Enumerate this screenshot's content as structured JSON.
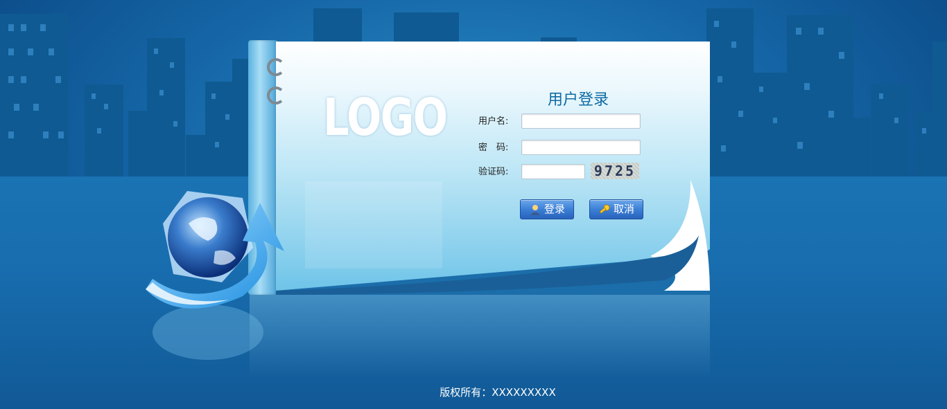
{
  "form": {
    "title": "用户登录",
    "username_label": "用户名:",
    "password_label": "密　码:",
    "captcha_label": "验证码:",
    "username_value": "",
    "password_value": "",
    "captcha_value": "",
    "captcha_code": "9725"
  },
  "buttons": {
    "login_label": "登录",
    "cancel_label": "取消",
    "login_icon": "user-icon",
    "cancel_icon": "key-icon"
  },
  "brand": {
    "logo_text": "LOGO"
  },
  "footer": {
    "copyright": "版权所有：XXXXXXXXX"
  },
  "colors": {
    "background": "#1667a8",
    "title": "#0d6aa3",
    "button": "#3c7fd5"
  }
}
